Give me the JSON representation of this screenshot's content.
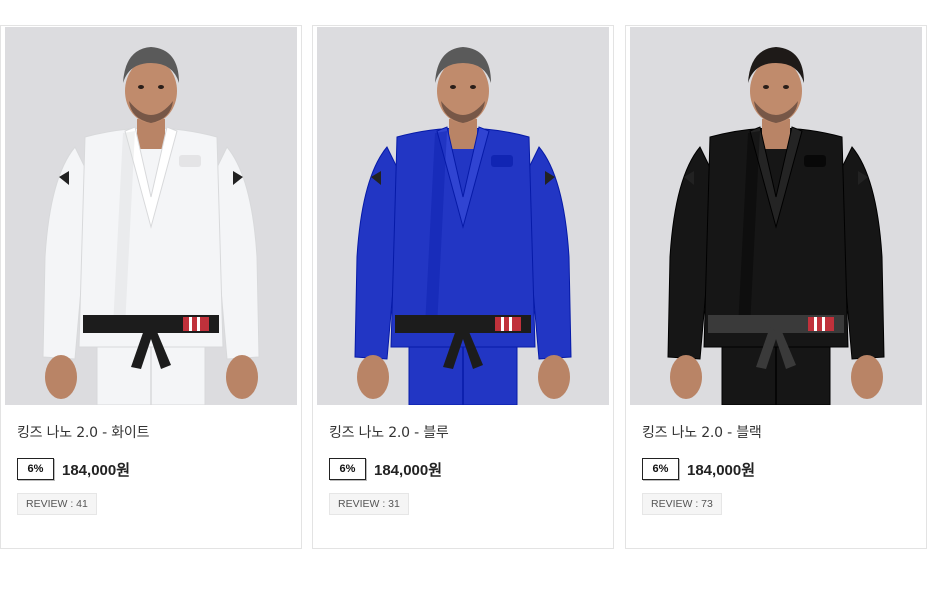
{
  "products": [
    {
      "name": "킹즈 나노 2.0 - 화이트",
      "discount": "6%",
      "price": "184,000원",
      "review": "REVIEW : 41",
      "gi_color": "#f4f5f7",
      "belt_color": "#1c1c1c",
      "hair_color": "#5a5a5a"
    },
    {
      "name": "킹즈 나노 2.0 - 블루",
      "discount": "6%",
      "price": "184,000원",
      "review": "REVIEW : 31",
      "gi_color": "#2236c4",
      "belt_color": "#1c1c1c",
      "hair_color": "#5a5a5a"
    },
    {
      "name": "킹즈 나노 2.0 - 블랙",
      "discount": "6%",
      "price": "184,000원",
      "review": "REVIEW : 73",
      "gi_color": "#161616",
      "belt_color": "#3a3a3a",
      "hair_color": "#1e1a18"
    }
  ]
}
